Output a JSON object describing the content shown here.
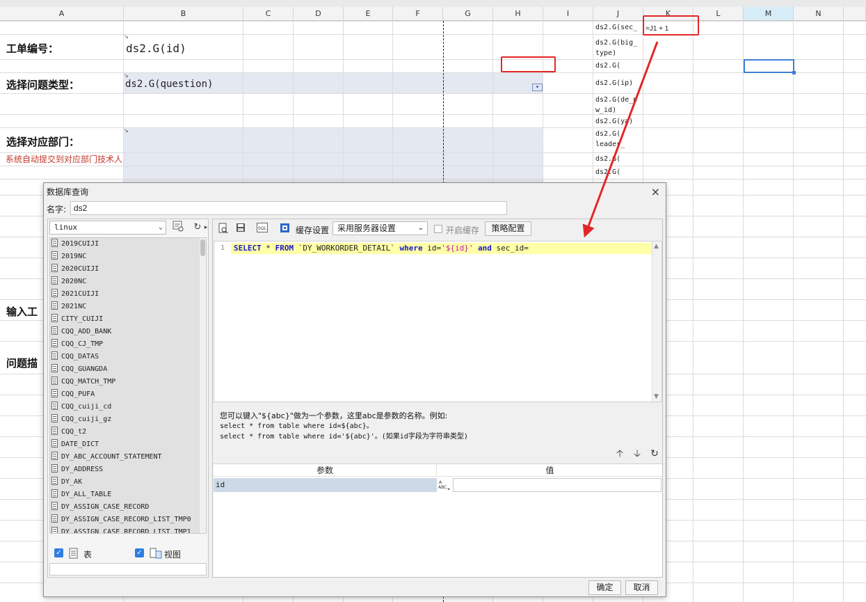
{
  "spreadsheet": {
    "columns": [
      "A",
      "B",
      "C",
      "D",
      "E",
      "F",
      "G",
      "H",
      "I",
      "J",
      "K",
      "L",
      "M",
      "N"
    ],
    "selected_column": "M",
    "labels": {
      "work_order_no": "工单编号：",
      "question_type": "选择问题类型：",
      "department": "选择对应部门：",
      "auto_submit_note": "系统自动提交到对应部门技术人",
      "input_partial": "输入工",
      "problem_partial": "问题描"
    },
    "cells": {
      "b_id": "ds2.G(id)",
      "b_question": "ds2.G(question)",
      "dropdown_glyph": "▾"
    },
    "j_column": [
      "ds2.G(sec_",
      "ds2.G(big_\ntype)",
      "ds2.G(",
      "ds2.G(ip)",
      "ds2.G(de_p\nw_id)",
      "ds2.G(ya)",
      "ds2.G(\nleader_",
      "ds2.G(",
      "ds2.G("
    ],
    "k1_formula": "=J1 + 1"
  },
  "dialog": {
    "title": "数据库查询",
    "close_icon": "×",
    "name_label": "名字:",
    "name_value": "ds2",
    "connection": "linux",
    "tables": [
      "2019CUIJI",
      "2019NC",
      "2020CUIJI",
      "2020NC",
      "2021CUIJI",
      "2021NC",
      "CITY_CUIJI",
      "CQQ_ADD_BANK",
      "CQQ_CJ_TMP",
      "CQQ_DATAS",
      "CQQ_GUANGDA",
      "CQQ_MATCH_TMP",
      "CQQ_PUFA",
      "CQQ_cuiji_cd",
      "CQQ_cuiji_gz",
      "CQQ_t2",
      "DATE_DICT",
      "DY_ABC_ACCOUNT_STATEMENT",
      "DY_ADDRESS",
      "DY_AK",
      "DY_ALL_TABLE",
      "DY_ASSIGN_CASE_RECORD",
      "DY_ASSIGN_CASE_RECORD_LIST_TMP0",
      "DY_ASSIGN_CASE_RECORD_LIST_TMP1"
    ],
    "show_tables_label": "表",
    "show_views_label": "视图",
    "cache_label": "缓存设置",
    "cache_option": "采用服务器设置",
    "enable_cache_label": "开启缓存",
    "policy_button": "策略配置",
    "line_number": "1",
    "sql": {
      "t1": "SELECT",
      "t2": " * ",
      "t3": "FROM",
      "t4": " `DY_WORKORDER_DETAIL` ",
      "t5": "where",
      "t6": " id=",
      "t7": "'${id}'",
      "t8": " ",
      "t9": "and",
      "t10": " sec_id="
    },
    "hint_line1": "您可以键入\"${abc}\"做为一个参数，这里abc是参数的名称。例如:",
    "hint_line2": "select * from table where id=${abc}。",
    "hint_line3": "select * from table where id='${abc}'。(如果id字段为字符串类型)",
    "param_header_name": "参数",
    "param_header_value": "值",
    "param_name": "id",
    "param_type": "ABC",
    "ok_button": "确定",
    "cancel_button": "取消"
  },
  "colors": {
    "highlight_red": "#e32626",
    "selection_blue": "#3f7fd6",
    "sql_keyword": "#1a1acc",
    "sql_string": "#c217a8",
    "line_highlight": "#ffffa8"
  }
}
